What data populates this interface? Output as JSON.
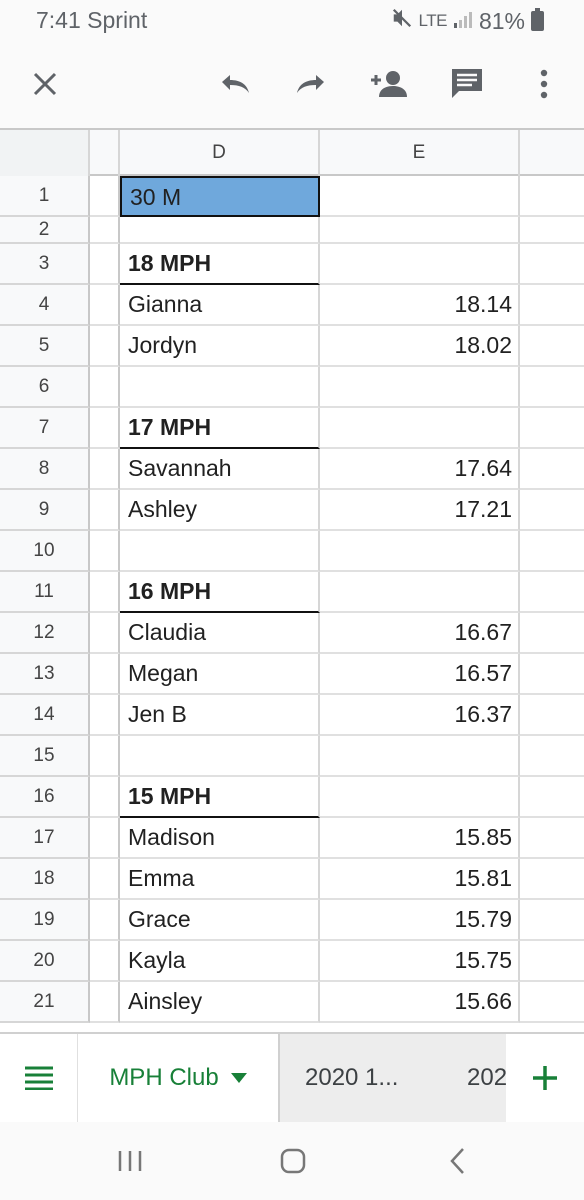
{
  "status_bar": {
    "time": "7:41",
    "carrier": "Sprint",
    "network": "LTE",
    "battery": "81%"
  },
  "toolbar": {
    "close_icon": "close-icon",
    "undo_icon": "undo-icon",
    "redo_icon": "redo-icon",
    "share_icon": "add-person-icon",
    "comment_icon": "comment-icon",
    "more_icon": "more-vertical-icon"
  },
  "columns": [
    "D",
    "E"
  ],
  "rows": [
    {
      "n": "1",
      "d": "30 M",
      "e": "",
      "style": "selected"
    },
    {
      "n": "2",
      "d": "",
      "e": "",
      "style": ""
    },
    {
      "n": "3",
      "d": "18 MPH",
      "e": "",
      "style": "header"
    },
    {
      "n": "4",
      "d": "Gianna",
      "e": "18.14",
      "style": ""
    },
    {
      "n": "5",
      "d": "Jordyn",
      "e": "18.02",
      "style": ""
    },
    {
      "n": "6",
      "d": "",
      "e": "",
      "style": ""
    },
    {
      "n": "7",
      "d": "17 MPH",
      "e": "",
      "style": "header"
    },
    {
      "n": "8",
      "d": "Savannah",
      "e": "17.64",
      "style": ""
    },
    {
      "n": "9",
      "d": "Ashley",
      "e": "17.21",
      "style": ""
    },
    {
      "n": "10",
      "d": "",
      "e": "",
      "style": ""
    },
    {
      "n": "11",
      "d": "16 MPH",
      "e": "",
      "style": "header"
    },
    {
      "n": "12",
      "d": "Claudia",
      "e": "16.67",
      "style": ""
    },
    {
      "n": "13",
      "d": "Megan",
      "e": "16.57",
      "style": ""
    },
    {
      "n": "14",
      "d": "Jen B",
      "e": "16.37",
      "style": ""
    },
    {
      "n": "15",
      "d": "",
      "e": "",
      "style": ""
    },
    {
      "n": "16",
      "d": "15 MPH",
      "e": "",
      "style": "header"
    },
    {
      "n": "17",
      "d": "Madison",
      "e": "15.85",
      "style": ""
    },
    {
      "n": "18",
      "d": "Emma",
      "e": "15.81",
      "style": ""
    },
    {
      "n": "19",
      "d": "Grace",
      "e": "15.79",
      "style": ""
    },
    {
      "n": "20",
      "d": "Kayla",
      "e": "15.75",
      "style": ""
    },
    {
      "n": "21",
      "d": "Ainsley",
      "e": "15.66",
      "style": ""
    }
  ],
  "sheets": {
    "active": "MPH Club",
    "tab2": "2020 1...",
    "tab3": "202"
  },
  "colors": {
    "accent": "#188038",
    "selection": "#6fa8dc"
  }
}
